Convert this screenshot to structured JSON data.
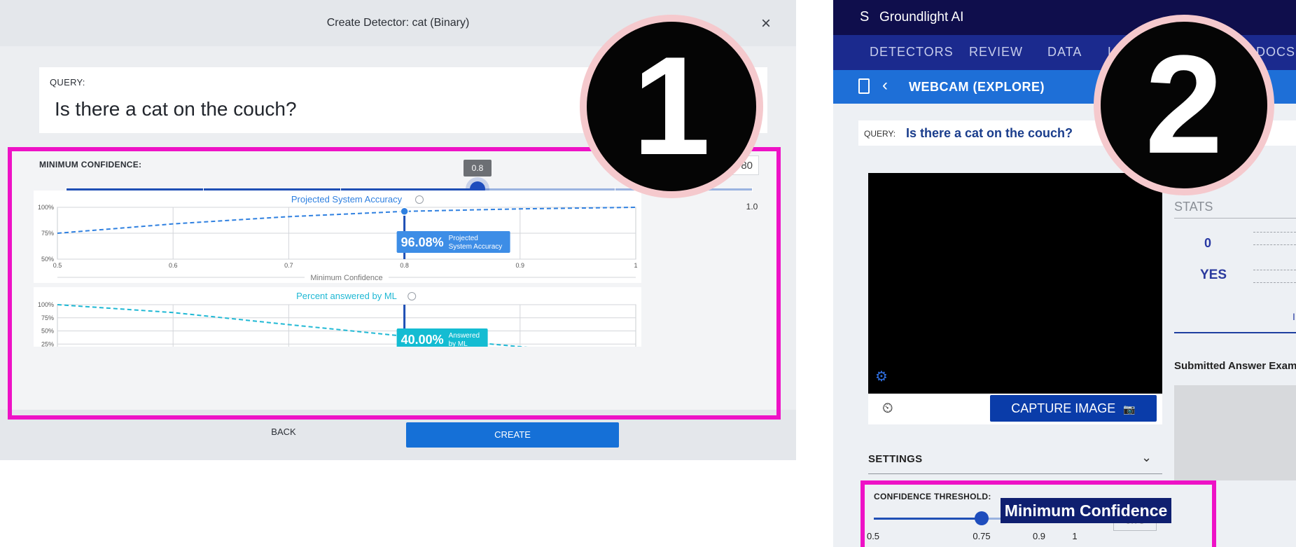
{
  "panel1": {
    "title": "Create Detector: cat (Binary)",
    "close_glyph": "×",
    "query_label": "QUERY:",
    "query": "Is there a cat on the couch?",
    "min_conf_label": "MINIMUM CONFIDENCE:",
    "min_conf_value_visible": "80",
    "slider": {
      "min": 0.5,
      "max": 1.0,
      "value": 0.8,
      "tooltip": "0.8",
      "ticks": [
        "0.5",
        "0.6",
        "0.7",
        "0.8",
        "0.9",
        "1.0"
      ]
    },
    "charts_title_accuracy": "Projected System Accuracy",
    "charts_title_ml": "Percent answered by ML",
    "accuracy_callout_value": "96.08%",
    "accuracy_callout_label_1": "Projected",
    "accuracy_callout_label_2": "System Accuracy",
    "ml_callout_value": "40.00%",
    "ml_callout_label_1": "Answered",
    "ml_callout_label_2": "by ML",
    "x_axis_title": "Minimum Confidence",
    "back": "BACK",
    "create": "CREATE"
  },
  "chart_data": [
    {
      "type": "line",
      "title": "Projected System Accuracy",
      "xlabel": "Minimum Confidence",
      "ylabel": "",
      "x_ticks": [
        "0.5",
        "0.6",
        "0.7",
        "0.8",
        "0.9",
        "1"
      ],
      "y_ticks": [
        "100%",
        "75%",
        "50%"
      ],
      "xlim": [
        0.5,
        1.0
      ],
      "ylim": [
        50,
        100
      ],
      "series": [
        {
          "x": [
            0.5,
            0.6,
            0.7,
            0.8,
            0.9,
            1.0
          ],
          "y": [
            75,
            84,
            91,
            96.08,
            98.5,
            100
          ]
        }
      ],
      "highlight": {
        "x": 0.8,
        "y": 96.08
      },
      "color": "#2f80e0"
    },
    {
      "type": "line",
      "title": "Percent answered by ML",
      "xlabel": "",
      "ylabel": "",
      "y_ticks": [
        "100%",
        "75%",
        "50%",
        "25%"
      ],
      "xlim": [
        0.5,
        1.0
      ],
      "ylim": [
        0,
        100
      ],
      "series": [
        {
          "x": [
            0.5,
            0.6,
            0.7,
            0.8,
            0.9,
            1.0
          ],
          "y": [
            100,
            85,
            62,
            40,
            20,
            0
          ]
        }
      ],
      "highlight": {
        "x": 0.8,
        "y": 40.0
      },
      "color": "#1fb8d4"
    }
  ],
  "badges": {
    "one": "1",
    "two": "2"
  },
  "panel2": {
    "brand": "Groundlight AI",
    "logo_glyph": "S",
    "nav": [
      "DETECTORS",
      "REVIEW",
      "DATA",
      "L",
      "DOCS"
    ],
    "back_glyph": "‹",
    "detector_title": "WEBCAM (EXPLORE)",
    "query_label": "QUERY:",
    "query": "Is there a cat on the couch?",
    "gear_glyph": "⚙",
    "timer_glyph": "⏲",
    "capture": "CAPTURE IMAGE",
    "capture_glyph": "📷",
    "stats": "STATS",
    "stat_count": "0",
    "stat_yes": "YES",
    "stat_i": "I",
    "submitted": "Submitted Answer Exam",
    "settings": "SETTINGS",
    "settings_chevron": "⌄",
    "conf_label": "CONFIDENCE THRESHOLD:",
    "min_conf_tag": "Minimum Confidence",
    "slider_value": "0.75",
    "ticks": [
      "0.5",
      "0.75",
      "0.9",
      "1"
    ]
  }
}
